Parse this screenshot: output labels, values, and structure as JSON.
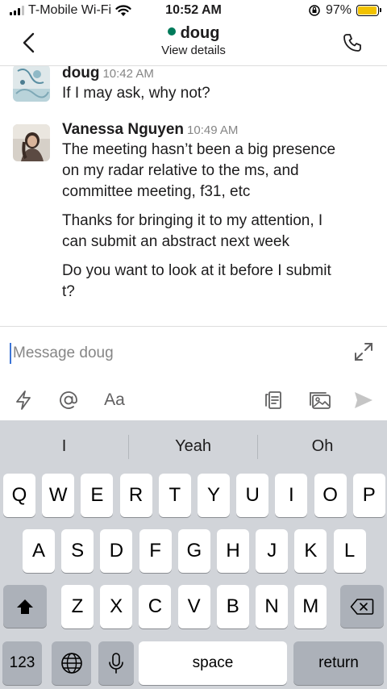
{
  "status_bar": {
    "carrier": "T-Mobile Wi-Fi",
    "time": "10:52 AM",
    "battery": "97%",
    "battery_level": 0.97,
    "battery_color": "#f2c200"
  },
  "header": {
    "title": "doug",
    "subtitle": "View details",
    "presence_color": "#007a5a"
  },
  "messages": [
    {
      "author": "doug",
      "time": "10:42 AM",
      "lines": [
        "If I may ask, why not?"
      ]
    },
    {
      "author": "Vanessa Nguyen",
      "time": "10:49 AM",
      "lines": [
        "The meeting hasn’t been a big presence",
        "on my radar relative to the ms, and",
        "committee meeting, f31, etc",
        "Thanks for bringing it to my attention, I",
        "can submit an abstract next week",
        "Do you want to look at it before I submit",
        "t?"
      ]
    }
  ],
  "composer": {
    "placeholder": "Message doug",
    "format_label": "Aa"
  },
  "keyboard": {
    "suggestions": [
      "I",
      "Yeah",
      "Oh"
    ],
    "row1": [
      "Q",
      "W",
      "E",
      "R",
      "T",
      "Y",
      "U",
      "I",
      "O",
      "P"
    ],
    "row2": [
      "A",
      "S",
      "D",
      "F",
      "G",
      "H",
      "J",
      "K",
      "L"
    ],
    "row3": [
      "Z",
      "X",
      "C",
      "V",
      "B",
      "N",
      "M"
    ],
    "numbers_label": "123",
    "space_label": "space",
    "return_label": "return"
  }
}
